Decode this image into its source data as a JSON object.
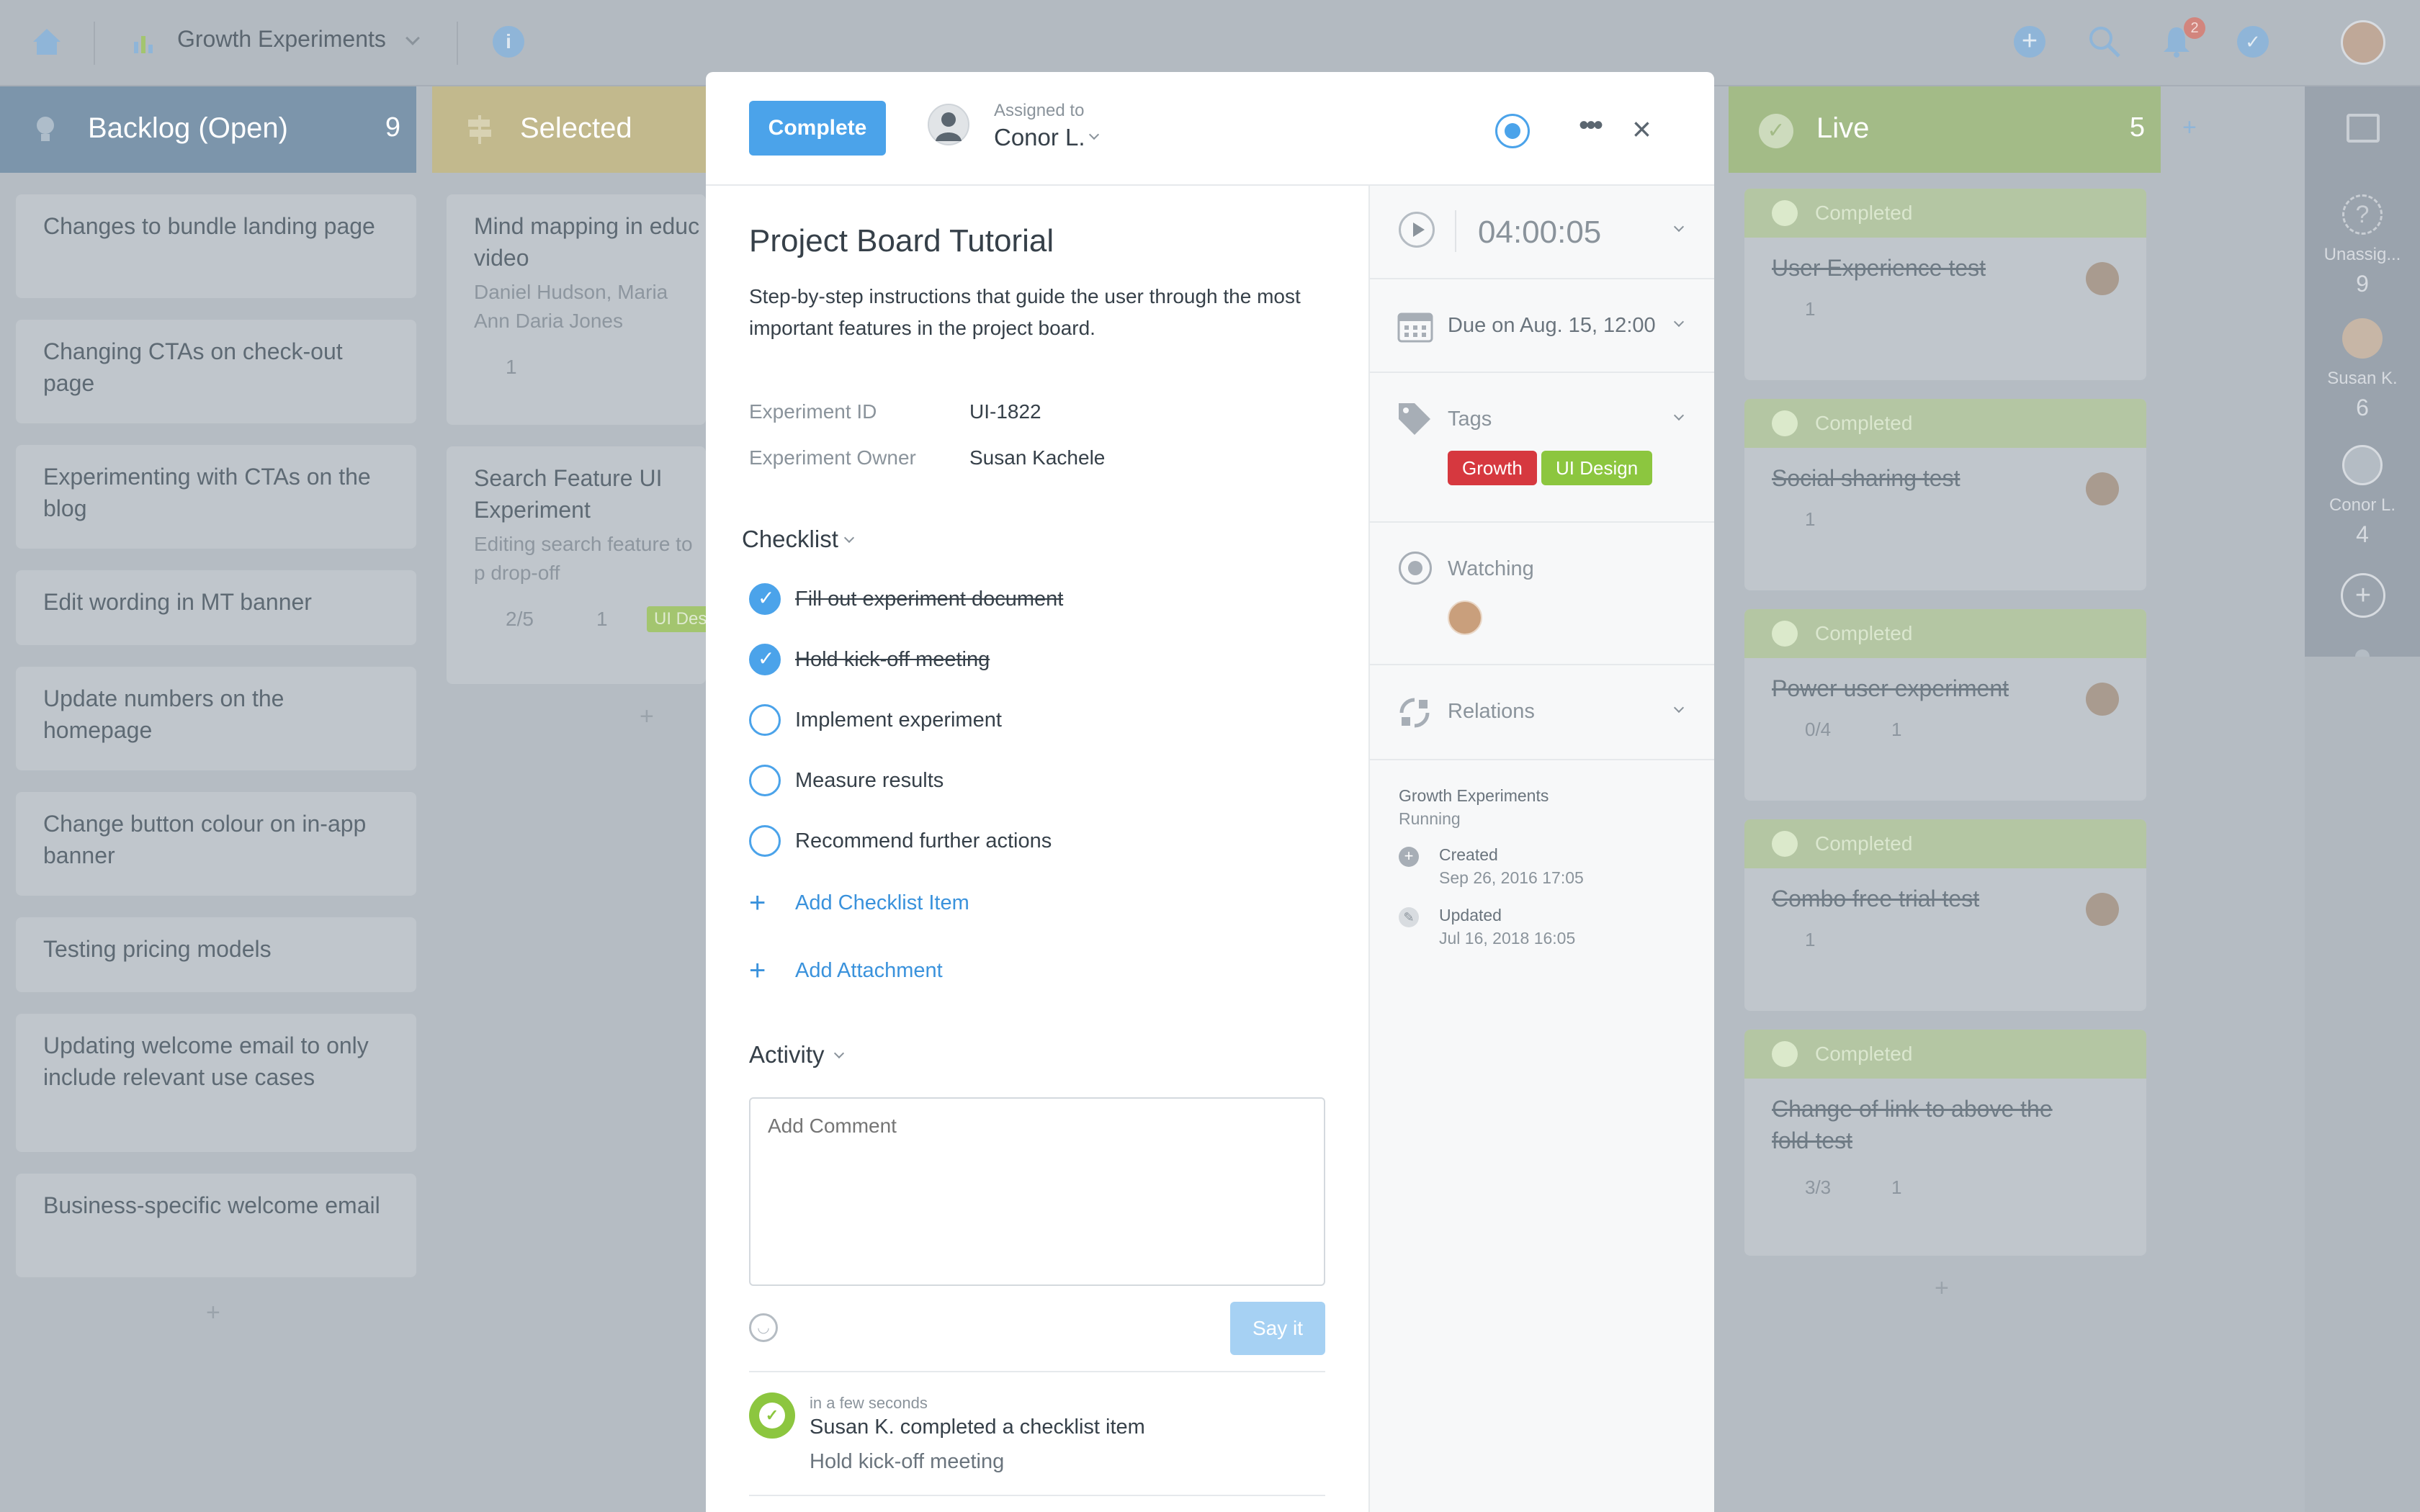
{
  "topbar": {
    "project": "Growth Experiments",
    "notif_count": "2",
    "icons": [
      "home-icon",
      "chart-icon",
      "info-icon",
      "add-icon",
      "search-icon",
      "bell-icon",
      "check-icon",
      "avatar"
    ]
  },
  "columns": {
    "backlog": {
      "title": "Backlog (Open)",
      "count": "9",
      "color": "#7c95ab",
      "cards": [
        "Changes to bundle landing page",
        "Changing CTAs on check-out page",
        "Experimenting with CTAs on the blog",
        "Edit wording in MT banner",
        "Update numbers on the homepage",
        "Change button colour on in-app banner",
        "Testing pricing models",
        "Updating welcome email to only include relevant use cases",
        "Business-specific welcome email"
      ]
    },
    "selected": {
      "title": "Selected",
      "color": "#c2b98d",
      "cards": [
        {
          "title": "Mind mapping in educ video",
          "sub": "Daniel Hudson, Maria Ann Daria Jones",
          "meta": "1"
        },
        {
          "title": "Search Feature UI Experiment",
          "sub": "Editing search feature to p drop-off",
          "meta": "2/5",
          "meta2": "1",
          "tag": "UI Design"
        }
      ]
    },
    "live": {
      "title": "Live",
      "count": "5",
      "color": "#a3bb87",
      "band": "Completed",
      "cards": [
        {
          "title": "User Experience test",
          "meta": "1"
        },
        {
          "title": "Social sharing test",
          "meta": "1"
        },
        {
          "title": "Power user experiment",
          "meta": "0/4",
          "meta2": "1"
        },
        {
          "title": "Combo free trial test",
          "meta": "1"
        },
        {
          "title": "Change of link to above the fold test",
          "meta": "3/3",
          "meta2": "1"
        }
      ]
    }
  },
  "rightrail": {
    "people": [
      {
        "name": "Unassig...",
        "count": "9"
      },
      {
        "name": "Susan K.",
        "count": "6"
      },
      {
        "name": "Conor L.",
        "count": "4"
      }
    ]
  },
  "modal": {
    "complete_label": "Complete",
    "assigned_label": "Assigned to",
    "assignee": "Conor L.",
    "title": "Project Board Tutorial",
    "description": "Step-by-step instructions that guide the user through the most important features in the project board.",
    "fields": [
      {
        "label": "Experiment ID",
        "value": "UI-1822"
      },
      {
        "label": "Experiment Owner",
        "value": "Susan Kachele"
      }
    ],
    "checklist_label": "Checklist",
    "checklist": [
      {
        "text": "Fill out experiment document",
        "done": true
      },
      {
        "text": "Hold kick-off meeting",
        "done": true
      },
      {
        "text": "Implement experiment",
        "done": false
      },
      {
        "text": "Measure results",
        "done": false
      },
      {
        "text": "Recommend further actions",
        "done": false
      }
    ],
    "add_checklist": "Add Checklist Item",
    "add_attachment": "Add Attachment",
    "activity_label": "Activity",
    "comment_placeholder": "Add Comment",
    "say_it": "Say it",
    "activity": {
      "time": "in a few seconds",
      "text": "Susan K. completed a checklist item",
      "item": "Hold kick-off meeting"
    },
    "side": {
      "timer": "04:00:05",
      "due": "Due on Aug. 15, 12:00",
      "tags_label": "Tags",
      "tags": [
        {
          "name": "Growth",
          "color": "#d6383f"
        },
        {
          "name": "UI Design",
          "color": "#8cc63f"
        }
      ],
      "watching_label": "Watching",
      "relations_label": "Relations",
      "board": "Growth Experiments",
      "status": "Running",
      "created_label": "Created",
      "created": "Sep 26, 2016 17:05",
      "updated_label": "Updated",
      "updated": "Jul 16, 2018 16:05"
    }
  }
}
